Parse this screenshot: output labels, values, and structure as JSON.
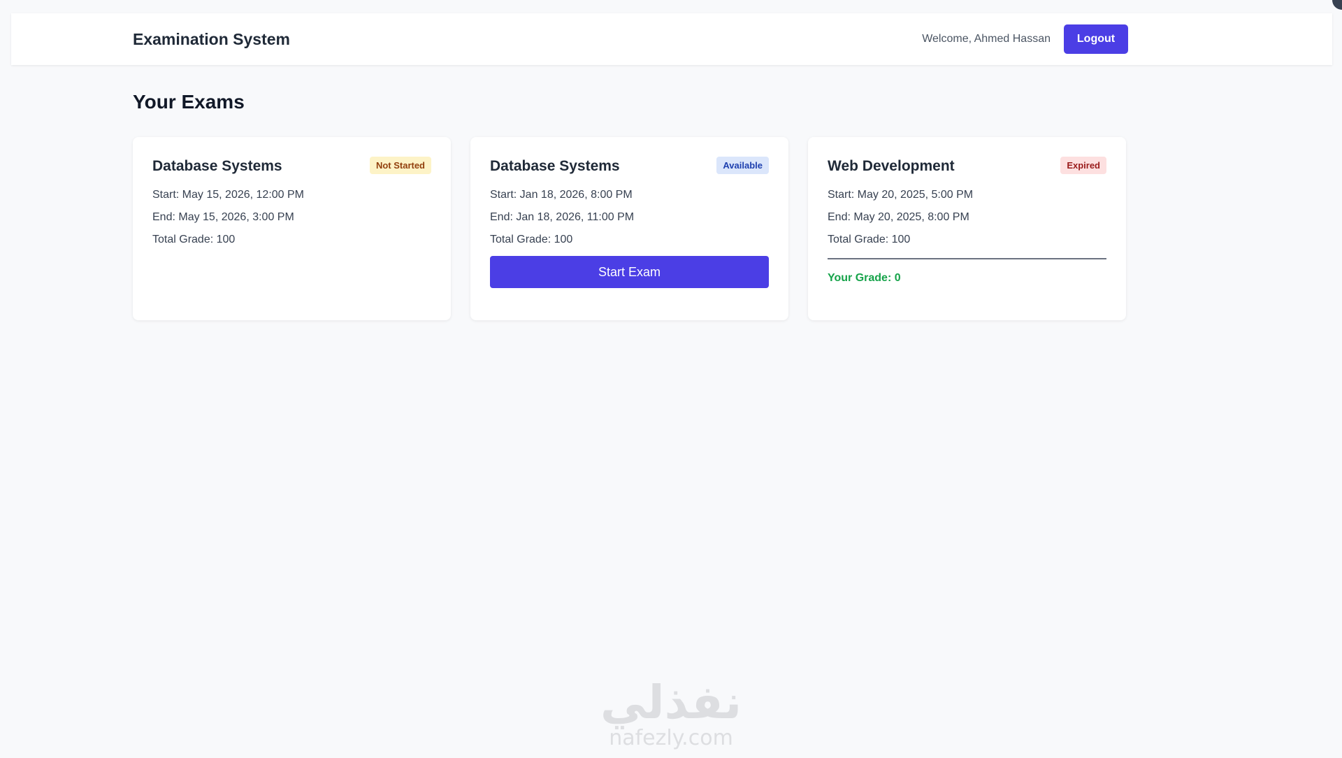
{
  "header": {
    "brand": "Examination System",
    "welcome": "Welcome, Ahmed Hassan",
    "logout_label": "Logout"
  },
  "main": {
    "title": "Your Exams",
    "exams": [
      {
        "name": "Database Systems",
        "status": "Not Started",
        "start": "Start: May 15, 2026, 12:00 PM",
        "end": "End: May 15, 2026, 3:00 PM",
        "total": "Total Grade: 100"
      },
      {
        "name": "Database Systems",
        "status": "Available",
        "start": "Start: Jan 18, 2026, 8:00 PM",
        "end": "End: Jan 18, 2026, 11:00 PM",
        "total": "Total Grade: 100",
        "action_label": "Start Exam"
      },
      {
        "name": "Web Development",
        "status": "Expired",
        "start": "Start: May 20, 2025, 5:00 PM",
        "end": "End: May 20, 2025, 8:00 PM",
        "total": "Total Grade: 100",
        "grade": "Your Grade: 0"
      }
    ]
  },
  "watermark": {
    "arabic": "نفذلي",
    "latin": "nafezly.com"
  },
  "colors": {
    "accent": "#4b3ee5",
    "badge_not_started_bg": "#fdf3c7",
    "badge_available_bg": "#dbe6fb",
    "badge_expired_bg": "#fde0e0",
    "grade_text": "#16a34a"
  }
}
